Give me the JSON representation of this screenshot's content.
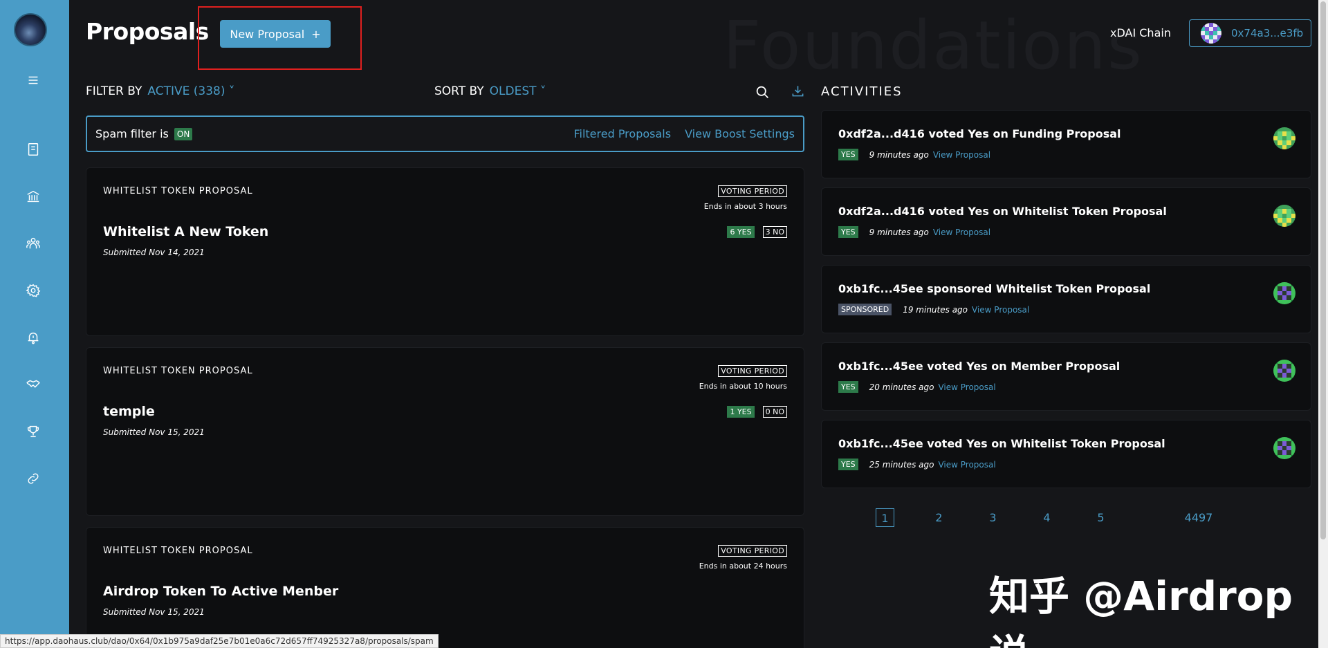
{
  "header": {
    "title": "Proposals",
    "new_proposal_label": "New Proposal",
    "new_proposal_icon": "+",
    "chain": "xDAI Chain",
    "account": "0x74a3...e3fb"
  },
  "filters": {
    "filter_label": "FILTER BY",
    "filter_value": "ACTIVE (338) ˅",
    "sort_label": "SORT BY",
    "sort_value": "OLDEST ˅"
  },
  "spam": {
    "text": "Spam filter is",
    "status": "ON",
    "link_filtered": "Filtered Proposals",
    "link_boost": "View Boost Settings"
  },
  "proposals": [
    {
      "type": "WHITELIST TOKEN PROPOSAL",
      "title": "Whitelist A New Token",
      "submitted": "Submitted Nov 14, 2021",
      "status": "VOTING PERIOD",
      "ends": "Ends in about 3 hours",
      "yes": "6 YES",
      "no": "3 NO"
    },
    {
      "type": "WHITELIST TOKEN PROPOSAL",
      "title": "temple",
      "submitted": "Submitted Nov 15, 2021",
      "status": "VOTING PERIOD",
      "ends": "Ends in about 10 hours",
      "yes": "1 YES",
      "no": "0 NO"
    },
    {
      "type": "WHITELIST TOKEN PROPOSAL",
      "title": "Airdrop Token To Active Menber",
      "submitted": "Submitted Nov 15, 2021",
      "status": "VOTING PERIOD",
      "ends": "Ends in about 24 hours"
    }
  ],
  "activities": {
    "title": "ACTIVITIES",
    "items": [
      {
        "text": "0xdf2a...d416 voted Yes on Funding Proposal",
        "badge": "YES",
        "time": "9 minutes ago",
        "link": "View Proposal"
      },
      {
        "text": "0xdf2a...d416 voted Yes on Whitelist Token Proposal",
        "badge": "YES",
        "time": "9 minutes ago",
        "link": "View Proposal"
      },
      {
        "text": "0xb1fc...45ee sponsored Whitelist Token Proposal",
        "badge": "SPONSORED",
        "time": "19 minutes ago",
        "link": "View Proposal"
      },
      {
        "text": "0xb1fc...45ee voted Yes on Member Proposal",
        "badge": "YES",
        "time": "20 minutes ago",
        "link": "View Proposal"
      },
      {
        "text": "0xb1fc...45ee voted Yes on Whitelist Token Proposal",
        "badge": "YES",
        "time": "25 minutes ago",
        "link": "View Proposal"
      }
    ]
  },
  "pagination": [
    "1",
    "2",
    "3",
    "4",
    "5",
    "4497"
  ],
  "sidebar_icons": [
    "menu-icon",
    "book-icon",
    "bank-icon",
    "members-icon",
    "settings-icon",
    "bell-icon",
    "handshake-icon",
    "trophy-icon",
    "link-icon"
  ],
  "watermarks": {
    "background": "Foundations",
    "overlay": "知乎 @Airdrop说"
  },
  "status_bar_url": "https://app.daohaus.club/dao/0x64/0x1b975a9daf25e7b01e0a6c72d657ff74925327a8/proposals/spam",
  "colors": {
    "accent": "#4a9cc7",
    "yes_green": "#2d7a4a",
    "sponsored_gray": "#4a5366",
    "highlight_red": "#e0201f"
  }
}
